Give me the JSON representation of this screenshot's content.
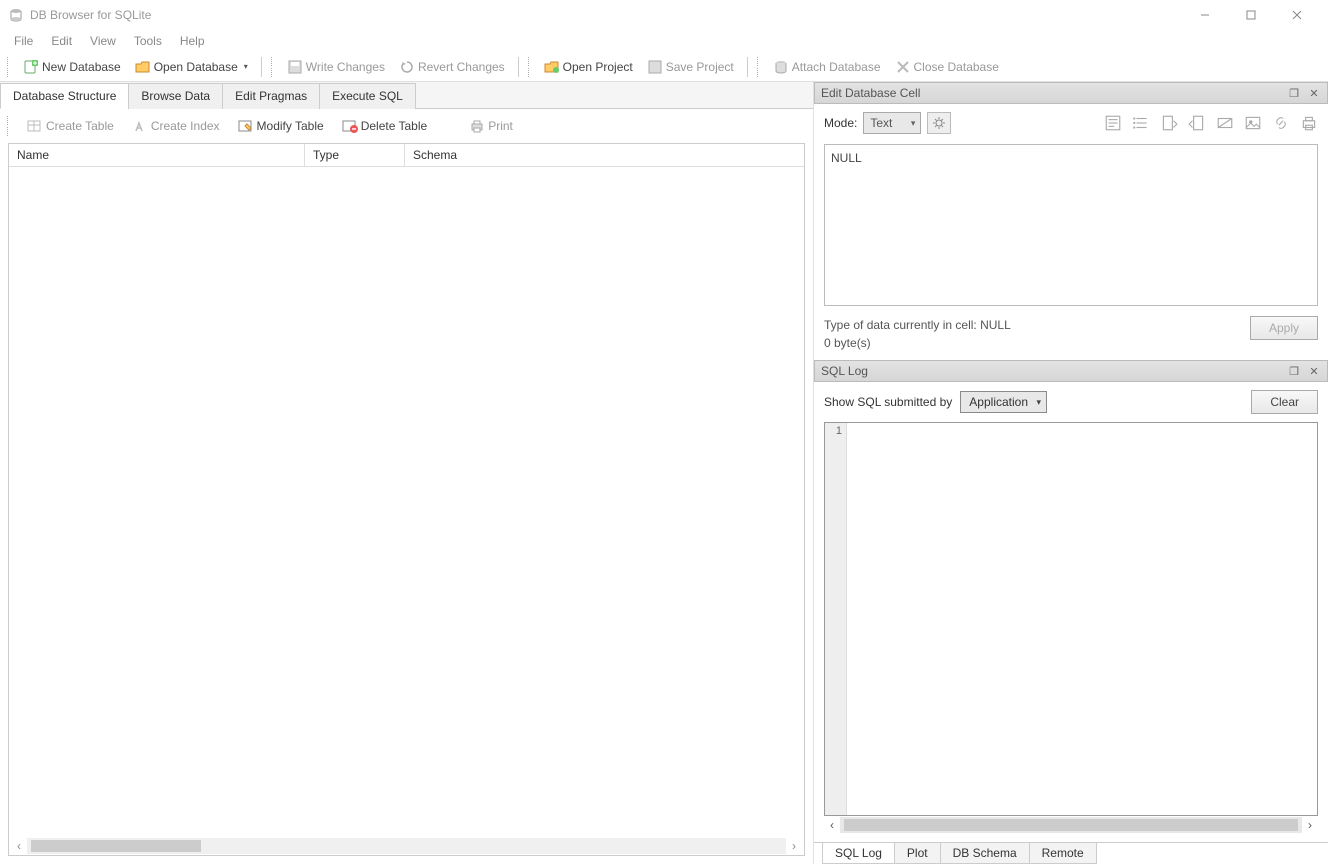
{
  "titlebar": {
    "title": "DB Browser for SQLite"
  },
  "menu": {
    "items": [
      "File",
      "Edit",
      "View",
      "Tools",
      "Help"
    ]
  },
  "toolbar": {
    "new_db": "New Database",
    "open_db": "Open Database",
    "write_changes": "Write Changes",
    "revert_changes": "Revert Changes",
    "open_project": "Open Project",
    "save_project": "Save Project",
    "attach_db": "Attach Database",
    "close_db": "Close Database"
  },
  "main_tabs": {
    "db_structure": "Database Structure",
    "browse_data": "Browse Data",
    "edit_pragmas": "Edit Pragmas",
    "execute_sql": "Execute SQL"
  },
  "subtoolbar": {
    "create_table": "Create Table",
    "create_index": "Create Index",
    "modify_table": "Modify Table",
    "delete_table": "Delete Table",
    "print": "Print"
  },
  "table_headers": {
    "name": "Name",
    "type": "Type",
    "schema": "Schema"
  },
  "edit_cell": {
    "title": "Edit Database Cell",
    "mode_label": "Mode:",
    "mode_value": "Text",
    "cell_value": "NULL",
    "type_line": "Type of data currently in cell: NULL",
    "size_line": "0 byte(s)",
    "apply": "Apply"
  },
  "sql_log": {
    "title": "SQL Log",
    "show_label": "Show SQL submitted by",
    "select_value": "Application",
    "clear": "Clear",
    "line_number": "1"
  },
  "bottom_tabs": {
    "sql_log": "SQL Log",
    "plot": "Plot",
    "db_schema": "DB Schema",
    "remote": "Remote"
  }
}
